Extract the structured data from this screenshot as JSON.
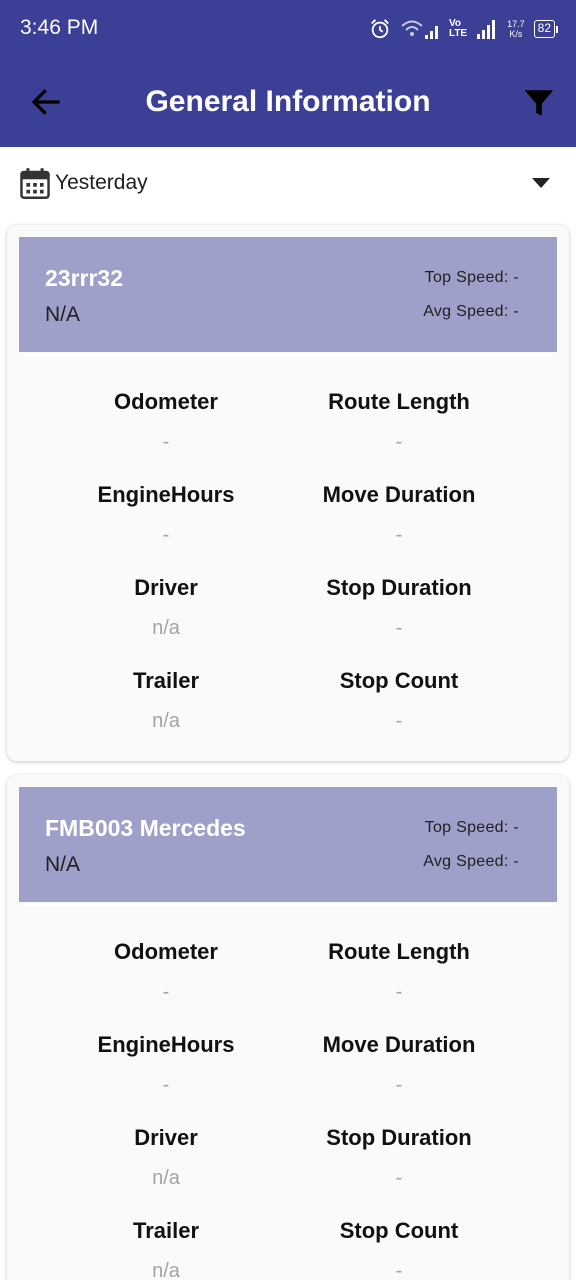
{
  "status": {
    "time": "3:46 PM",
    "volte_top": "Vo",
    "volte_bottom": "LTE",
    "net_speed_value": "17.7",
    "net_speed_unit": "K/s",
    "battery": "82",
    "icons": [
      "alarm-icon",
      "wifi-icon",
      "signal-icon",
      "signal-icon"
    ]
  },
  "appbar": {
    "title": "General Information",
    "back_icon": "arrow-left-icon",
    "filter_icon": "filter-icon"
  },
  "date_filter": {
    "selected": "Yesterday",
    "icon": "calendar-icon"
  },
  "colors": {
    "primary": "#3c3f96",
    "card_header": "#9fa0ca",
    "muted_value": "#a3a3a3"
  },
  "vehicles": [
    {
      "name": "23rrr32",
      "subtitle": "N/A",
      "top_speed": "Top Speed: -",
      "avg_speed": "Avg Speed: -",
      "stats": [
        {
          "left_label": "Odometer",
          "left_value": "-",
          "right_label": "Route Length",
          "right_value": "-"
        },
        {
          "left_label": "EngineHours",
          "left_value": "-",
          "right_label": "Move Duration",
          "right_value": "-"
        },
        {
          "left_label": "Driver",
          "left_value": "n/a",
          "right_label": "Stop Duration",
          "right_value": "-"
        },
        {
          "left_label": "Trailer",
          "left_value": "n/a",
          "right_label": "Stop Count",
          "right_value": "-"
        }
      ]
    },
    {
      "name": "FMB003 Mercedes",
      "subtitle": "N/A",
      "top_speed": "Top Speed: -",
      "avg_speed": "Avg Speed: -",
      "stats": [
        {
          "left_label": "Odometer",
          "left_value": "-",
          "right_label": "Route Length",
          "right_value": "-"
        },
        {
          "left_label": "EngineHours",
          "left_value": "-",
          "right_label": "Move Duration",
          "right_value": "-"
        },
        {
          "left_label": "Driver",
          "left_value": "n/a",
          "right_label": "Stop Duration",
          "right_value": "-"
        },
        {
          "left_label": "Trailer",
          "left_value": "n/a",
          "right_label": "Stop Count",
          "right_value": "-"
        }
      ]
    }
  ]
}
